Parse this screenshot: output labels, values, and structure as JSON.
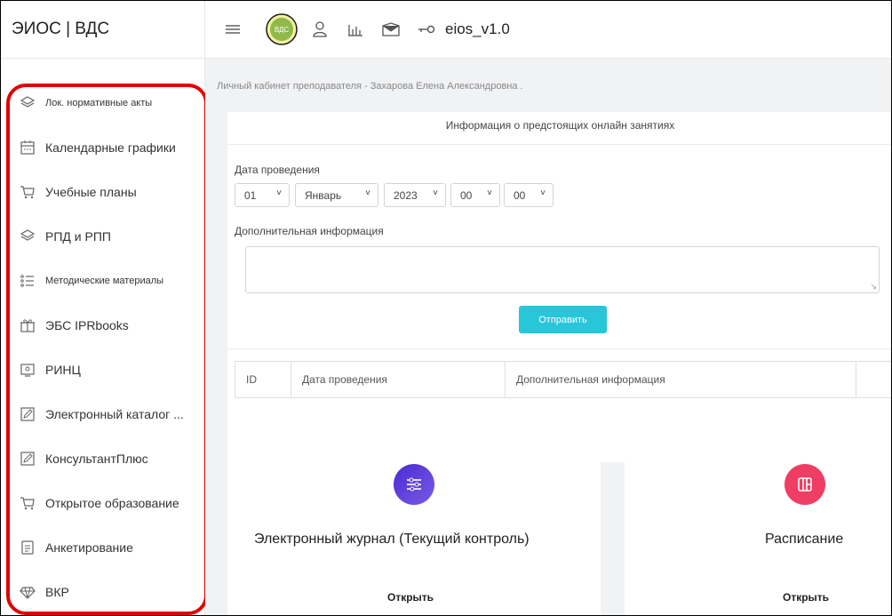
{
  "brand": "ЭИОС |  ВДС",
  "topbar": {
    "logo_text": "ВДС",
    "app_title": "eios_v1.0",
    "icons": [
      "menu-icon",
      "logo",
      "user-icon",
      "stats-icon",
      "mail-icon",
      "key-icon"
    ]
  },
  "sidebar": {
    "items": [
      {
        "label": "Лок. нормативные акты",
        "icon": "layers-icon"
      },
      {
        "label": "Календарные графики",
        "icon": "calendar-icon"
      },
      {
        "label": "Учебные планы",
        "icon": "cart-icon"
      },
      {
        "label": "РПД и РПП",
        "icon": "layers-icon"
      },
      {
        "label": "Методические материалы",
        "icon": "list-icon"
      },
      {
        "label": "ЭБС IPRbooks",
        "icon": "gift-icon"
      },
      {
        "label": "РИНЦ",
        "icon": "screen-icon"
      },
      {
        "label": "Электронный каталог ...",
        "icon": "edit-icon"
      },
      {
        "label": "КонсультантПлюс",
        "icon": "edit-icon"
      },
      {
        "label": "Открытое образование",
        "icon": "cart-icon"
      },
      {
        "label": "Анкетирование",
        "icon": "document-icon"
      },
      {
        "label": "ВКР",
        "icon": "diamond-icon"
      }
    ],
    "highlight_color": "#e00000"
  },
  "main": {
    "breadcrumb": "Личный кабинет преподавателя - Захарова Елена Александровна .",
    "form": {
      "title": "Информация о предстоящих онлайн занятиях",
      "date_label": "Дата проведения",
      "day": "01",
      "month": "Январь",
      "year": "2023",
      "hour": "00",
      "minute": "00",
      "extra_label": "Дополнительная информация",
      "submit": "Отправить",
      "submit_color": "#27c6d9"
    },
    "table": {
      "columns": [
        "ID",
        "Дата проведения",
        "Дополнительная информация",
        ""
      ]
    },
    "tiles": [
      {
        "title": "Электронный журнал (Текущий контроль)",
        "link": "Открыть",
        "icon": "sliders-icon",
        "color": "#5a3fd6"
      },
      {
        "title": "Расписание",
        "link": "Открыть",
        "icon": "columns-icon",
        "color": "#ef3d63"
      }
    ]
  }
}
